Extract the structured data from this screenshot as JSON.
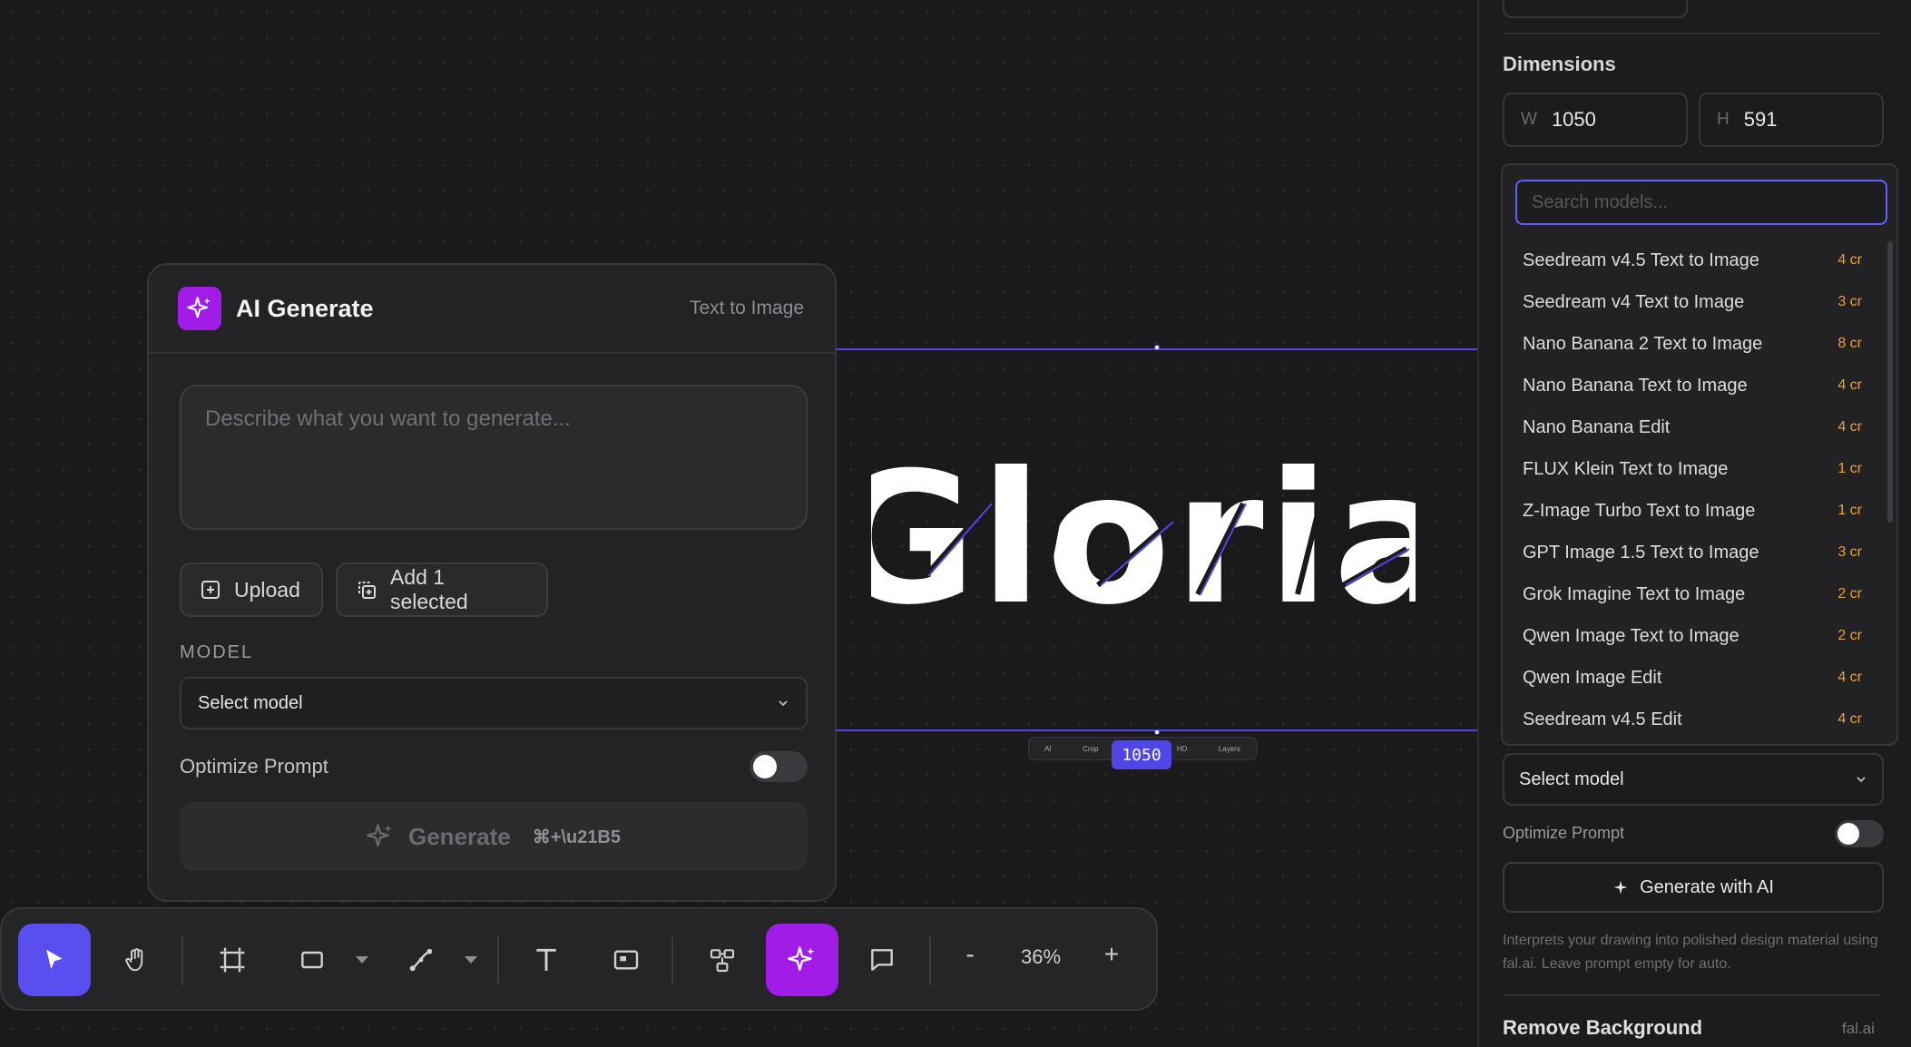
{
  "canvas": {
    "logo_text": "Gloria",
    "width_badge": "1050",
    "mini_toolbar": [
      "AI",
      "Crop",
      "1050",
      "HD",
      "Layers"
    ]
  },
  "ai_panel": {
    "title": "AI Generate",
    "subtitle": "Text to Image",
    "prompt_placeholder": "Describe what you want to generate...",
    "upload_label": "Upload",
    "add_selected_label": "Add 1 selected",
    "model_label": "MODEL",
    "model_select_value": "Select model",
    "optimize_label": "Optimize Prompt",
    "generate_label": "Generate",
    "generate_shortcut": "⌘+\\u21B5"
  },
  "toolbar": {
    "zoom_level": "36%",
    "zoom_out": "-",
    "zoom_in": "+"
  },
  "sidebar": {
    "dimensions_title": "Dimensions",
    "width_prefix": "W",
    "width_value": "1050",
    "height_prefix": "H",
    "height_value": "591",
    "select_model": "Select model",
    "optimize_label": "Optimize Prompt",
    "generate_ai_label": "Generate with AI",
    "description": "Interprets your drawing into polished design material using fal.ai. Leave prompt empty for auto.",
    "remove_bg_title": "Remove Background",
    "remove_bg_provider": "fal.ai"
  },
  "dropdown": {
    "search_placeholder": "Search models...",
    "items": [
      {
        "name": "Seedream v4.5 Text to Image",
        "cost": "4 cr"
      },
      {
        "name": "Seedream v4 Text to Image",
        "cost": "3 cr"
      },
      {
        "name": "Nano Banana 2 Text to Image",
        "cost": "8 cr"
      },
      {
        "name": "Nano Banana Text to Image",
        "cost": "4 cr"
      },
      {
        "name": "Nano Banana Edit",
        "cost": "4 cr"
      },
      {
        "name": "FLUX Klein Text to Image",
        "cost": "1 cr"
      },
      {
        "name": "Z-Image Turbo Text to Image",
        "cost": "1 cr"
      },
      {
        "name": "GPT Image 1.5 Text to Image",
        "cost": "3 cr"
      },
      {
        "name": "Grok Imagine Text to Image",
        "cost": "2 cr"
      },
      {
        "name": "Qwen Image Text to Image",
        "cost": "2 cr"
      },
      {
        "name": "Qwen Image Edit",
        "cost": "4 cr"
      },
      {
        "name": "Seedream v4.5 Edit",
        "cost": "4 cr"
      }
    ]
  },
  "colors": {
    "accent_blue": "#5b4ef0",
    "accent_purple": "#a21ce8",
    "cost_orange": "#e8a33a"
  }
}
